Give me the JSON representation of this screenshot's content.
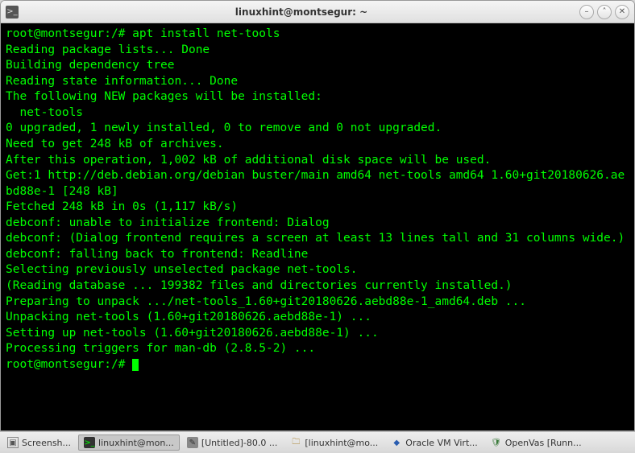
{
  "window": {
    "title": "linuxhint@montsegur: ~"
  },
  "terminal": {
    "lines": [
      "root@montsegur:/# apt install net-tools",
      "Reading package lists... Done",
      "Building dependency tree",
      "Reading state information... Done",
      "The following NEW packages will be installed:",
      "  net-tools",
      "0 upgraded, 1 newly installed, 0 to remove and 0 not upgraded.",
      "Need to get 248 kB of archives.",
      "After this operation, 1,002 kB of additional disk space will be used.",
      "Get:1 http://deb.debian.org/debian buster/main amd64 net-tools amd64 1.60+git20180626.aebd88e-1 [248 kB]",
      "Fetched 248 kB in 0s (1,117 kB/s)",
      "debconf: unable to initialize frontend: Dialog",
      "debconf: (Dialog frontend requires a screen at least 13 lines tall and 31 columns wide.)",
      "debconf: falling back to frontend: Readline",
      "Selecting previously unselected package net-tools.",
      "(Reading database ... 199382 files and directories currently installed.)",
      "Preparing to unpack .../net-tools_1.60+git20180626.aebd88e-1_amd64.deb ...",
      "Unpacking net-tools (1.60+git20180626.aebd88e-1) ...",
      "Setting up net-tools (1.60+git20180626.aebd88e-1) ...",
      "Processing triggers for man-db (2.8.5-2) ...",
      "root@montsegur:/# "
    ]
  },
  "taskbar": {
    "items": [
      {
        "label": "Screensh...",
        "icon": "shot"
      },
      {
        "label": "linuxhint@mon...",
        "icon": "term",
        "active": true
      },
      {
        "label": "[Untitled]-80.0 ...",
        "icon": "edit"
      },
      {
        "label": "[linuxhint@mo...",
        "icon": "files"
      },
      {
        "label": "Oracle VM Virt...",
        "icon": "vbox"
      },
      {
        "label": "OpenVas [Runn...",
        "icon": "shield"
      }
    ]
  }
}
